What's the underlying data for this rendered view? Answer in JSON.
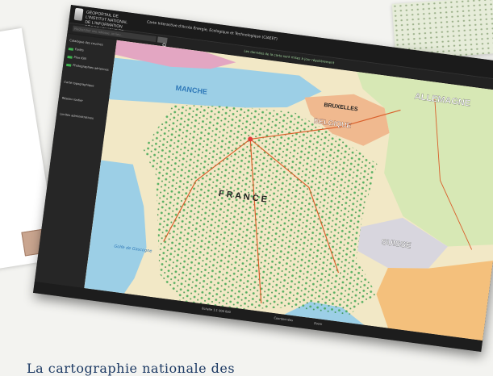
{
  "header": {
    "brand": "Géoportail de l'Institut National de l'Information Géographique et Forestière",
    "title": "Carte Interactive d'Accès Énergie, Ecologique et Technologique (CIAEET)",
    "notice": "Les données de la carte sont mises à jour régulièrement"
  },
  "search": {
    "placeholder": "Rechercher une adresse, un lieu...",
    "value": ""
  },
  "sidebar": {
    "items": [
      {
        "label": "Catalogue des couches"
      },
      {
        "label": "Forêts"
      },
      {
        "label": "Plan IGN"
      },
      {
        "label": "Photographies aériennes"
      },
      {
        "label": "Carte topographique"
      },
      {
        "label": "Réseau routier"
      },
      {
        "label": "Limites administratives"
      }
    ]
  },
  "map": {
    "labels": {
      "allemagne": "ALLEMAGNE",
      "belgique": "BELGIQUE",
      "bruxelles": "BRUXELLES",
      "manche": "MANCHE",
      "france": "F R A N C E",
      "suisse": "SUISSE",
      "golfe": "Golfe de Gascogne"
    },
    "colors": {
      "land_fr": "#f2e8c6",
      "forest": "#3aa54f",
      "sea": "#9ccfe6",
      "germany": "#d7e8b5",
      "belgium": "#f0b98f",
      "switzerland": "#d8d6de",
      "italy": "#f4c07c",
      "uk": "#e3a6c2",
      "road": "#d95f2b"
    }
  },
  "footer": {
    "scale": "Échelle 1:1 000 000",
    "coords": "Coordonnées",
    "zoom": "Zoom"
  },
  "caption": "La cartographie nationale des"
}
